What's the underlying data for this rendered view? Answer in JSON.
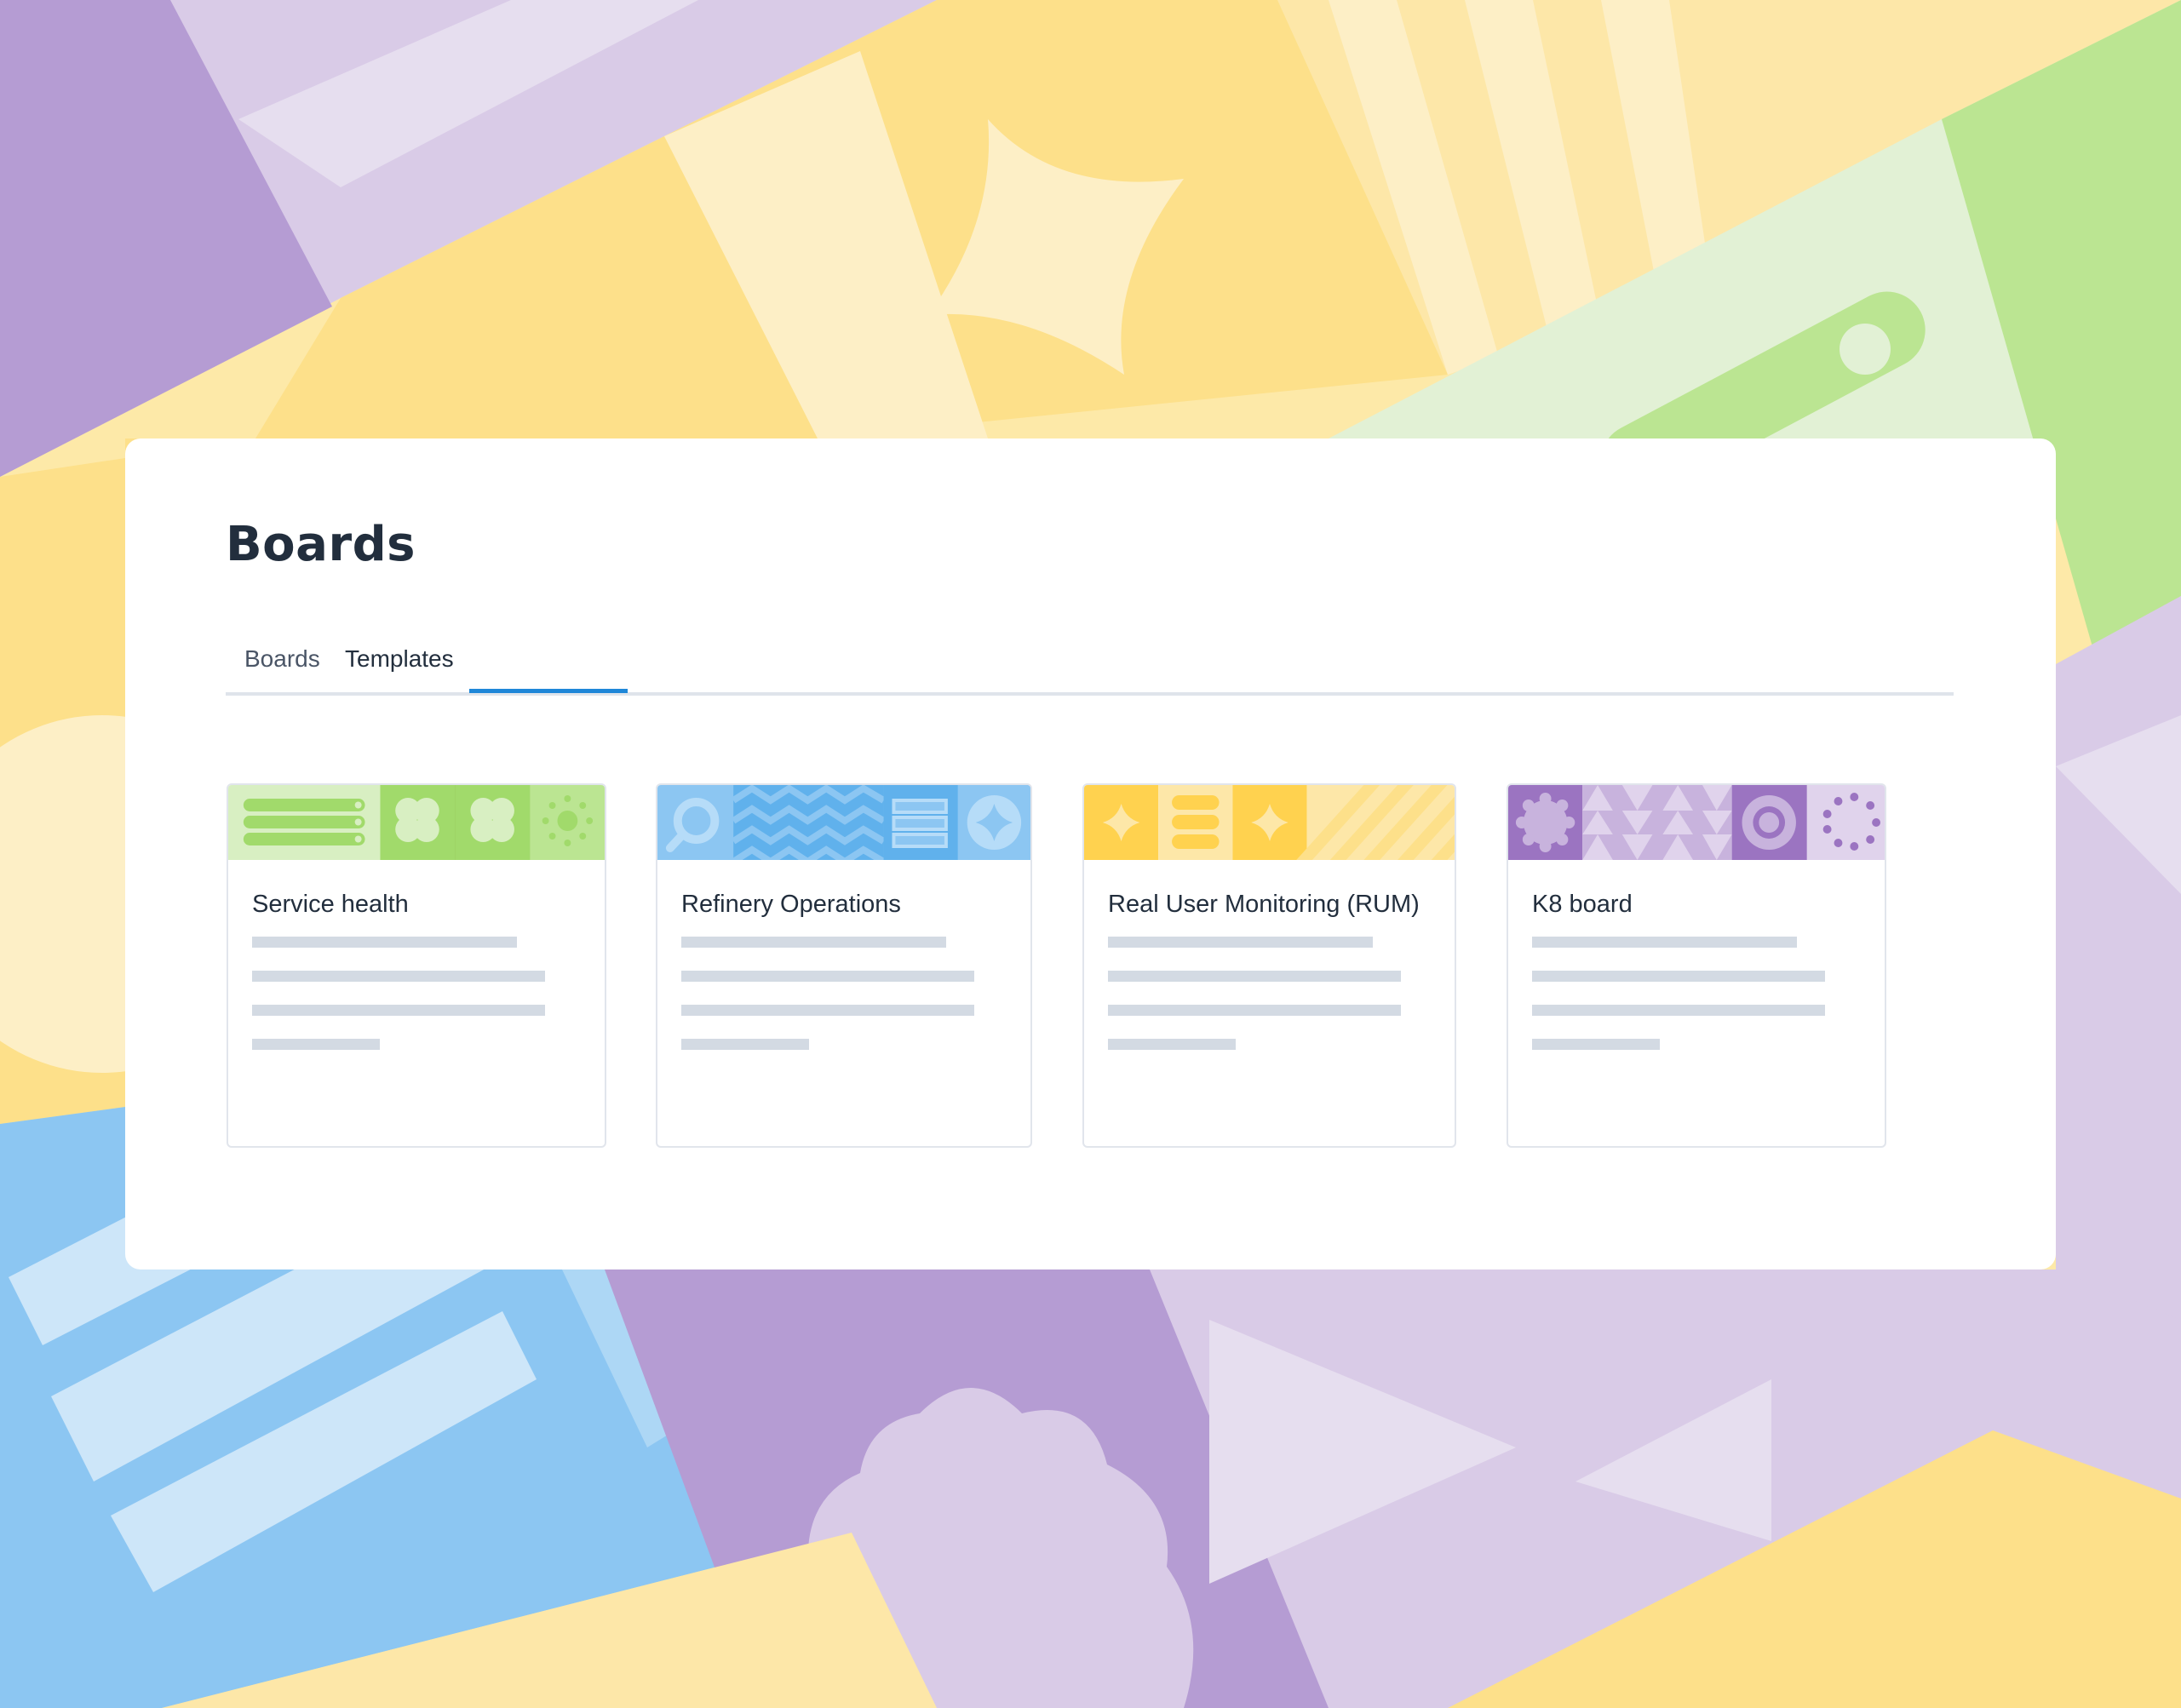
{
  "page": {
    "title": "Boards",
    "tabs": [
      {
        "label": "Boards",
        "active": false
      },
      {
        "label": "Templates",
        "active": true
      }
    ],
    "accent_color": "#1f87d8"
  },
  "templates": [
    {
      "title": "Service health",
      "theme": "green",
      "banner_icons": [
        "list-icon",
        "flower-icon",
        "flower-icon",
        "sun-dots-icon"
      ]
    },
    {
      "title": "Refinery Operations",
      "theme": "blue",
      "banner_icons": [
        "search-icon",
        "zigzag-pattern",
        "server-icon",
        "sparkle-icon"
      ]
    },
    {
      "title": "Real User Monitoring (RUM)",
      "theme": "yellow",
      "banner_icons": [
        "sparkle-icon",
        "stack-icon",
        "sparkle-icon",
        "stripe-pattern"
      ]
    },
    {
      "title": "K8 board",
      "theme": "purple",
      "banner_icons": [
        "badge-icon",
        "triangle-pattern",
        "target-icon",
        "dotted-circle-icon"
      ]
    }
  ],
  "colors": {
    "green": [
      "#d8efc2",
      "#a1da6b",
      "#bbe592"
    ],
    "blue": [
      "#8cc6f2",
      "#60b1ec",
      "#b6dcf8"
    ],
    "yellow": [
      "#ffd24f",
      "#fde7a8",
      "#fde08a"
    ],
    "purple": [
      "#9b74c1",
      "#c8b3dd",
      "#e0d3ec"
    ]
  }
}
